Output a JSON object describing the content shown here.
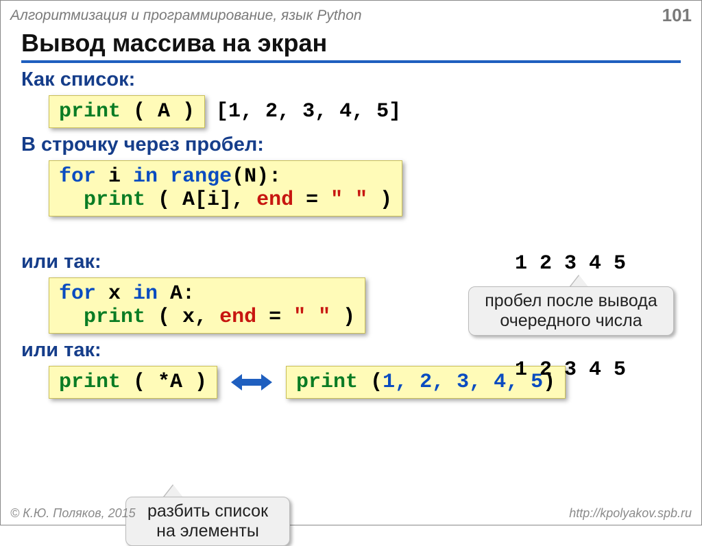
{
  "header": {
    "course": "Алгоритмизация и программирование, язык Python",
    "page": "101"
  },
  "title": "Вывод массива на экран",
  "sec1": {
    "heading": "Как список:",
    "code_print": "print",
    "code_args": " ( A )",
    "output": "[1, 2, 3, 4, 5]"
  },
  "sec2": {
    "heading": "В строчку через пробел:",
    "l1_for": "for",
    "l1_mid": " i ",
    "l1_in": "in",
    "l1_sp": " ",
    "l1_range": "range",
    "l1_tail": "(N):",
    "l2_print": "  print",
    "l2_args": " ( A[i], ",
    "l2_end": "end",
    "l2_assign": " = ",
    "l2_str": "\" \"",
    "l2_close": " )",
    "output": "1 2 3 4 5",
    "callout": "пробел после вывода очередного числа"
  },
  "sec3": {
    "heading": "или так:",
    "l1_for": "for",
    "l1_mid": " x ",
    "l1_in": "in",
    "l1_tail": " A:",
    "l2_print": "  print",
    "l2_args": " ( x, ",
    "l2_end": "end",
    "l2_assign": " = ",
    "l2_str": "\" \"",
    "l2_close": " )",
    "output": "1 2 3 4 5"
  },
  "sec4": {
    "heading": "или так:",
    "left_print": "print",
    "left_args": " ( *A )",
    "right_print": "print",
    "right_open": " (",
    "right_args": "1, 2, 3, 4, 5",
    "right_close": ")",
    "callout": "разбить список на элементы"
  },
  "footer": {
    "copyright": "© К.Ю. Поляков, 2015",
    "url": "http://kpolyakov.spb.ru"
  }
}
